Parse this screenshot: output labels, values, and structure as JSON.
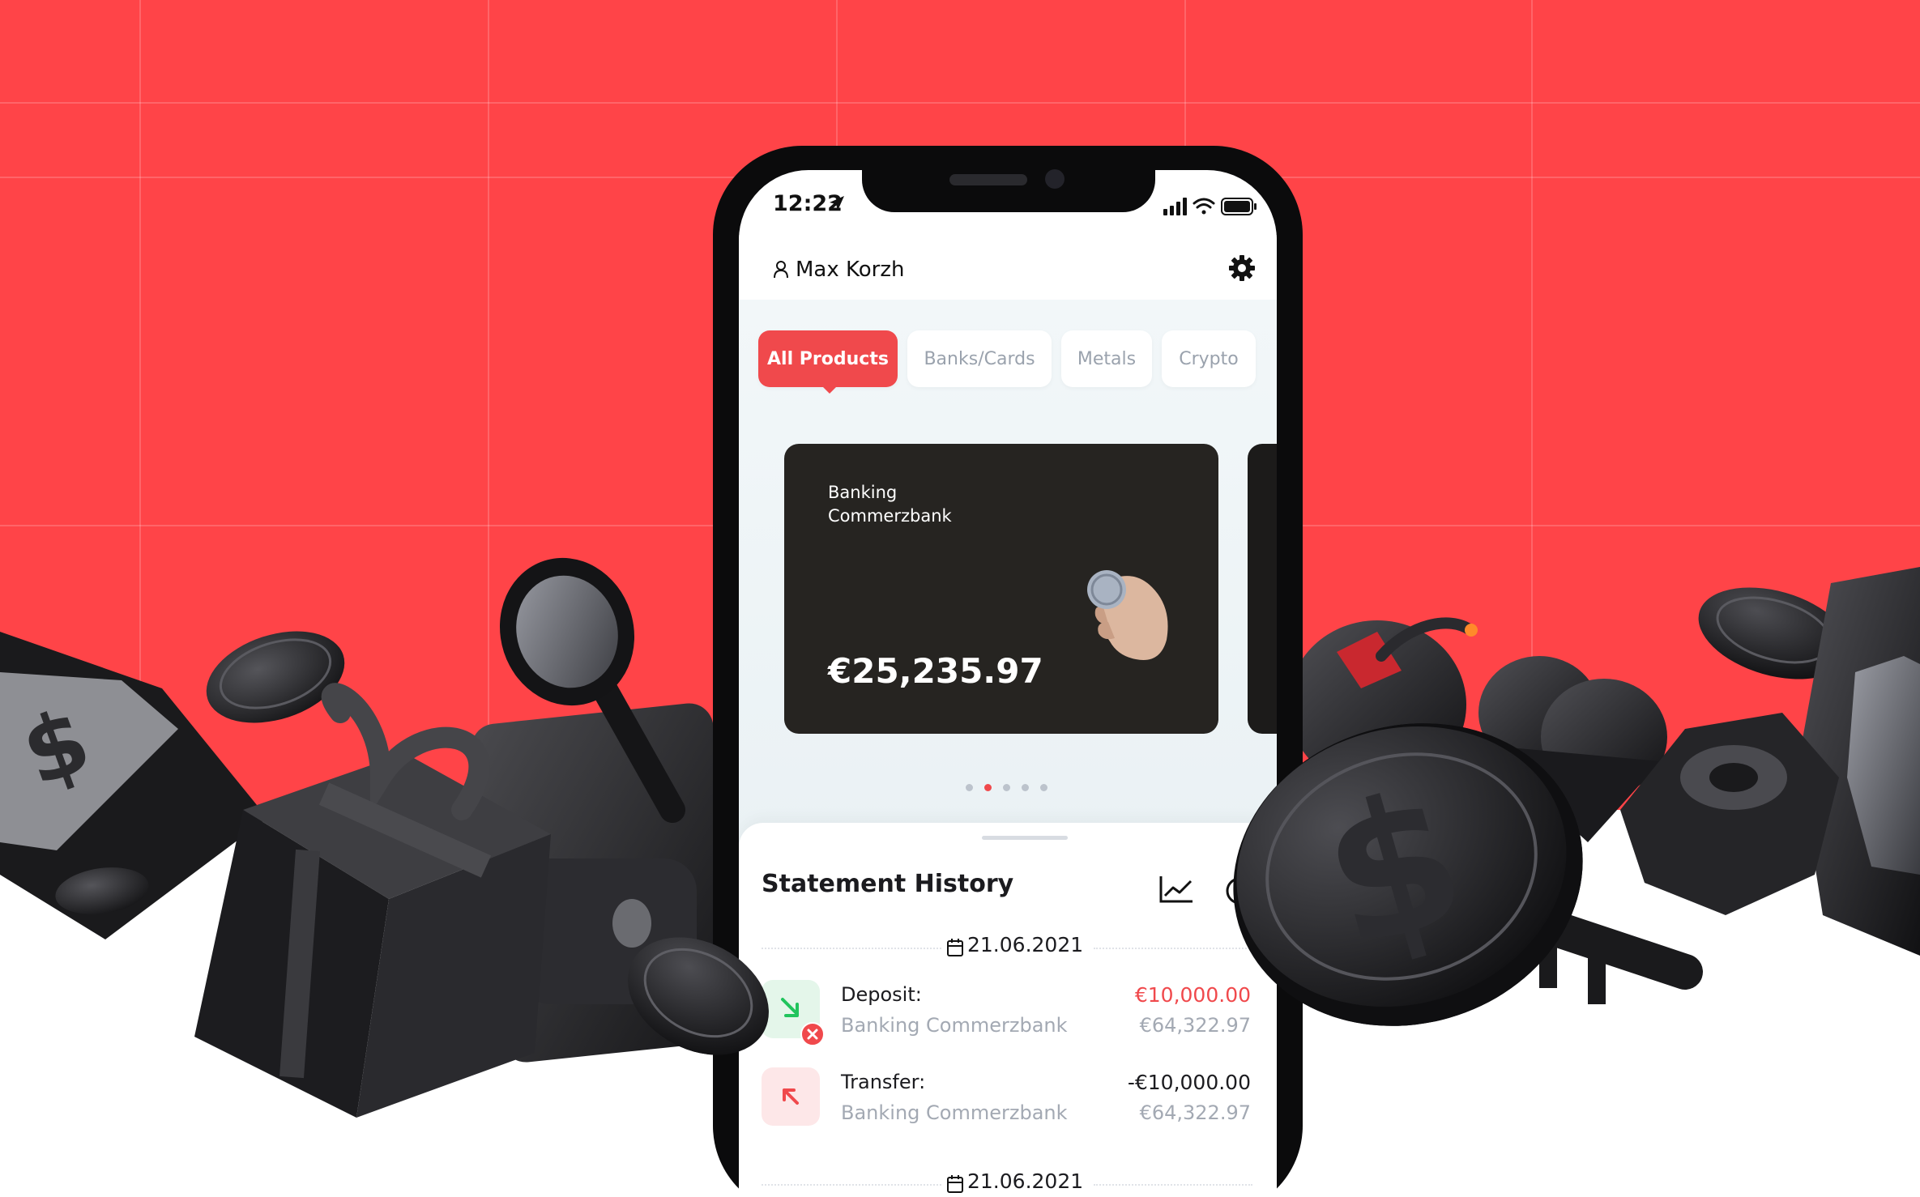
{
  "status_bar": {
    "time": "12:22"
  },
  "header": {
    "username": "Max Korzh"
  },
  "tabs": [
    {
      "label": "All Products",
      "active": true
    },
    {
      "label": "Banks/Cards",
      "active": false
    },
    {
      "label": "Metals",
      "active": false
    },
    {
      "label": "Crypto",
      "active": false
    }
  ],
  "card": {
    "title_line1": "Banking",
    "title_line2": "Commerzbank",
    "amount": "€25,235.97"
  },
  "carousel": {
    "count": 5,
    "active_index": 1
  },
  "statement": {
    "title": "Statement History",
    "groups": [
      {
        "date": "21.06.2021",
        "transactions": [
          {
            "label": "Deposit:",
            "source": "Banking Commerzbank",
            "amount": "€10,000.00",
            "balance": "€64,322.97",
            "amount_color": "#f0494c",
            "icon": "arrow-down-right-icon",
            "icon_color": "#21c45d",
            "icon_bg": "#e4f6ea"
          },
          {
            "label": "Transfer:",
            "source": "Banking Commerzbank",
            "amount": "-€10,000.00",
            "balance": "€64,322.97",
            "amount_color": "#1b1b1f",
            "icon": "arrow-up-left-icon",
            "icon_color": "#f0494c",
            "icon_bg": "#fde7e8"
          }
        ]
      },
      {
        "date": "21.06.2021",
        "transactions": []
      }
    ]
  },
  "colors": {
    "accent": "#f0494c",
    "background": "#ff4448",
    "card": "#262421"
  }
}
